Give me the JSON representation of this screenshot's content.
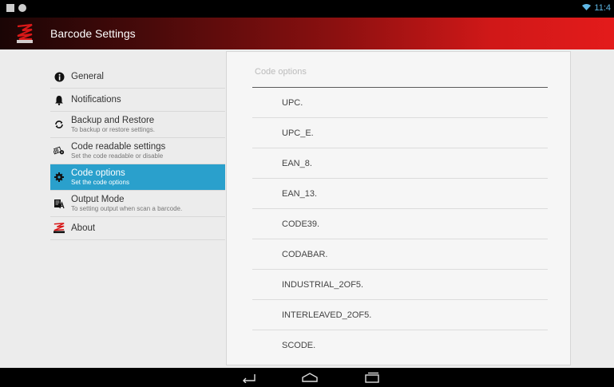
{
  "status": {
    "time": "11:4"
  },
  "app": {
    "title": "Barcode Settings"
  },
  "menu": [
    {
      "title": "General",
      "subtitle": "",
      "icon": "info-icon"
    },
    {
      "title": "Notifications",
      "subtitle": "",
      "icon": "bell-icon"
    },
    {
      "title": "Backup and Restore",
      "subtitle": "To backup or restore settings.",
      "icon": "sync-icon"
    },
    {
      "title": "Code readable settings",
      "subtitle": "Set the code readable or disable",
      "icon": "barcode-gear-icon"
    },
    {
      "title": "Code options",
      "subtitle": "Set the code options",
      "icon": "gear-icon"
    },
    {
      "title": "Output Mode",
      "subtitle": "To setting output when scan a barcode.",
      "icon": "output-icon"
    },
    {
      "title": "About",
      "subtitle": "",
      "icon": "zebex-logo-icon"
    }
  ],
  "panel": {
    "title": "Code options",
    "items": [
      "UPC.",
      "UPC_E.",
      "EAN_8.",
      "EAN_13.",
      "CODE39.",
      "CODABAR.",
      "INDUSTRIAL_2OF5.",
      "INTERLEAVED_2OF5.",
      "SCODE."
    ]
  },
  "colors": {
    "selected": "#2aa0cc",
    "accent": "#e31b1b"
  }
}
